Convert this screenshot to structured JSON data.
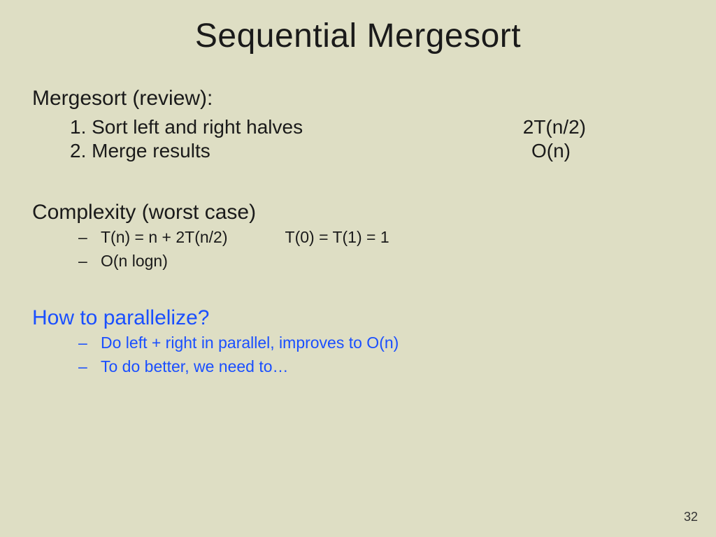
{
  "title": "Sequential Mergesort",
  "section1": {
    "heading": "Mergesort (review):",
    "items": [
      {
        "label": "1. Sort left and right halves",
        "cost": "2T(n/2)"
      },
      {
        "label": "2. Merge results",
        "cost": "O(n)"
      }
    ]
  },
  "section2": {
    "heading": "Complexity (worst case)",
    "items": [
      {
        "text": "T(n) = n + 2T(n/2)",
        "text2": "T(0) = T(1) = 1"
      },
      {
        "text": "O(n logn)"
      }
    ]
  },
  "section3": {
    "heading": "How to parallelize?",
    "items": [
      {
        "text": "Do left + right in parallel, improves to O(n)"
      },
      {
        "text": "To do better, we need to…"
      }
    ]
  },
  "pageNumber": "32",
  "dash": "–"
}
